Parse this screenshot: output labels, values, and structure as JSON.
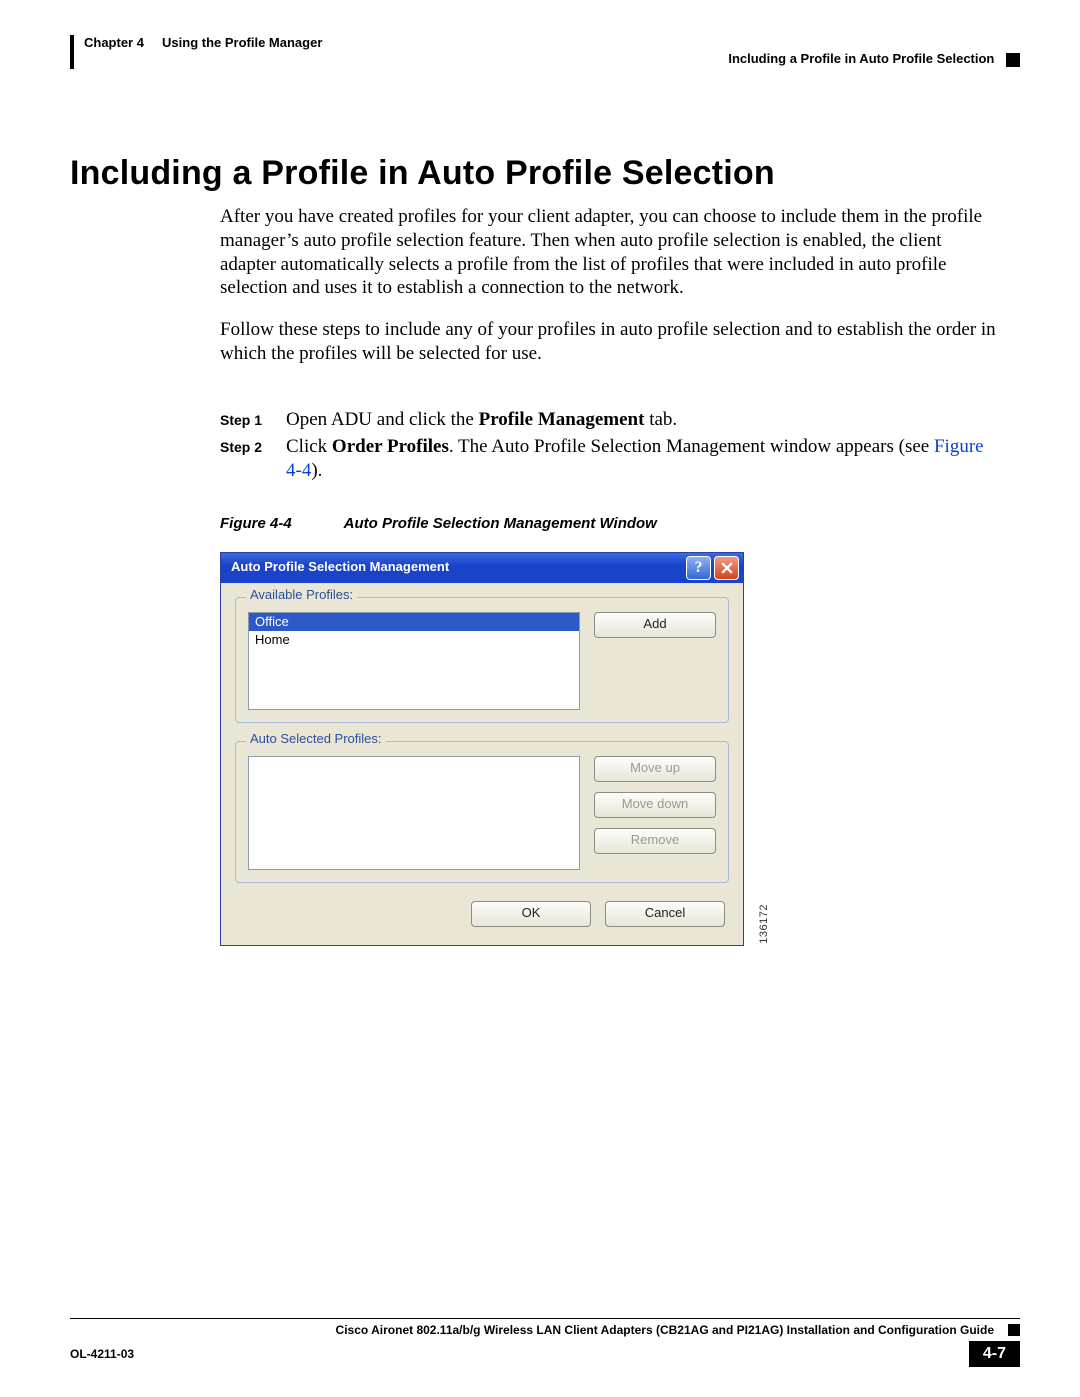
{
  "header": {
    "chapter_label": "Chapter 4",
    "chapter_title": "Using the Profile Manager",
    "section": "Including a Profile in Auto Profile Selection"
  },
  "title": "Including a Profile in Auto Profile Selection",
  "paragraphs": {
    "p1": "After you have created profiles for your client adapter, you can choose to include them in the profile manager’s auto profile selection feature. Then when auto profile selection is enabled, the client adapter automatically selects a profile from the list of profiles that were included in auto profile selection and uses it to establish a connection to the network.",
    "p2": "Follow these steps to include any of your profiles in auto profile selection and to establish the order in which the profiles will be selected for use."
  },
  "steps": {
    "s1_label": "Step 1",
    "s1_a": "Open ADU and click the ",
    "s1_b": "Profile Management",
    "s1_c": " tab.",
    "s2_label": "Step 2",
    "s2_a": "Click ",
    "s2_b": "Order Profiles",
    "s2_c": ". The Auto Profile Selection Management window appears (see ",
    "s2_ref": "Figure 4-4",
    "s2_d": ")."
  },
  "figure": {
    "num": "Figure 4-4",
    "caption": "Auto Profile Selection Management Window",
    "image_id": "136172"
  },
  "dialog": {
    "title": "Auto Profile Selection Management",
    "help_symbol": "?",
    "group1": "Available Profiles:",
    "group2": "Auto Selected Profiles:",
    "list1": [
      "Office",
      "Home"
    ],
    "buttons": {
      "add": "Add",
      "moveup": "Move up",
      "movedown": "Move down",
      "remove": "Remove",
      "ok": "OK",
      "cancel": "Cancel"
    }
  },
  "footer": {
    "doc_title": "Cisco Aironet 802.11a/b/g Wireless LAN Client Adapters (CB21AG and PI21AG) Installation and Configuration Guide",
    "code": "OL-4211-03",
    "page": "4-7"
  }
}
